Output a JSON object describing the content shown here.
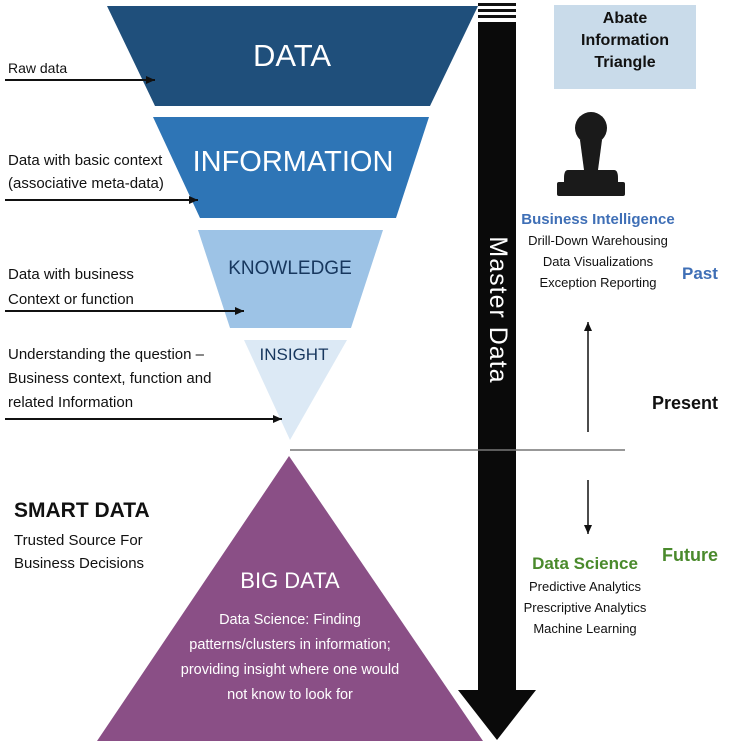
{
  "layers": {
    "data": "DATA",
    "information": "INFORMATION",
    "knowledge": "KNOWLEDGE",
    "insight": "INSIGHT"
  },
  "left_notes": {
    "raw_data": "Raw data",
    "basic_context": [
      "Data with basic context",
      "(associative meta-data)"
    ],
    "business_context": [
      "Data with business",
      "Context or function"
    ],
    "understanding": [
      "Understanding the question –",
      "Business context, function and",
      "related Information"
    ]
  },
  "smart_data": {
    "title": "SMART DATA",
    "lines": [
      "Trusted Source For",
      "Business Decisions"
    ]
  },
  "big_data": {
    "title": "BIG DATA",
    "lines": [
      "Data Science: Finding",
      "patterns/clusters in information;",
      "providing insight where one would",
      "not know to look for"
    ]
  },
  "master_data": "Master Data",
  "abate": [
    "Abate",
    "Information",
    "Triangle"
  ],
  "business_intelligence": {
    "title": "Business Intelligence",
    "items": [
      "Drill-Down Warehousing",
      "Data Visualizations",
      "Exception Reporting"
    ]
  },
  "timeline": {
    "past": "Past",
    "present": "Present",
    "future": "Future"
  },
  "data_science": {
    "title": "Data Science",
    "items": [
      "Predictive Analytics",
      "Prescriptive Analytics",
      "Machine Learning"
    ]
  },
  "colors": {
    "data": "#1f4f7b",
    "information": "#2e75b6",
    "knowledge": "#9dc3e6",
    "insight": "#dce9f5",
    "big_data": "#8a4f86",
    "past": "#3f6fb6",
    "future": "#4a8a2c"
  }
}
